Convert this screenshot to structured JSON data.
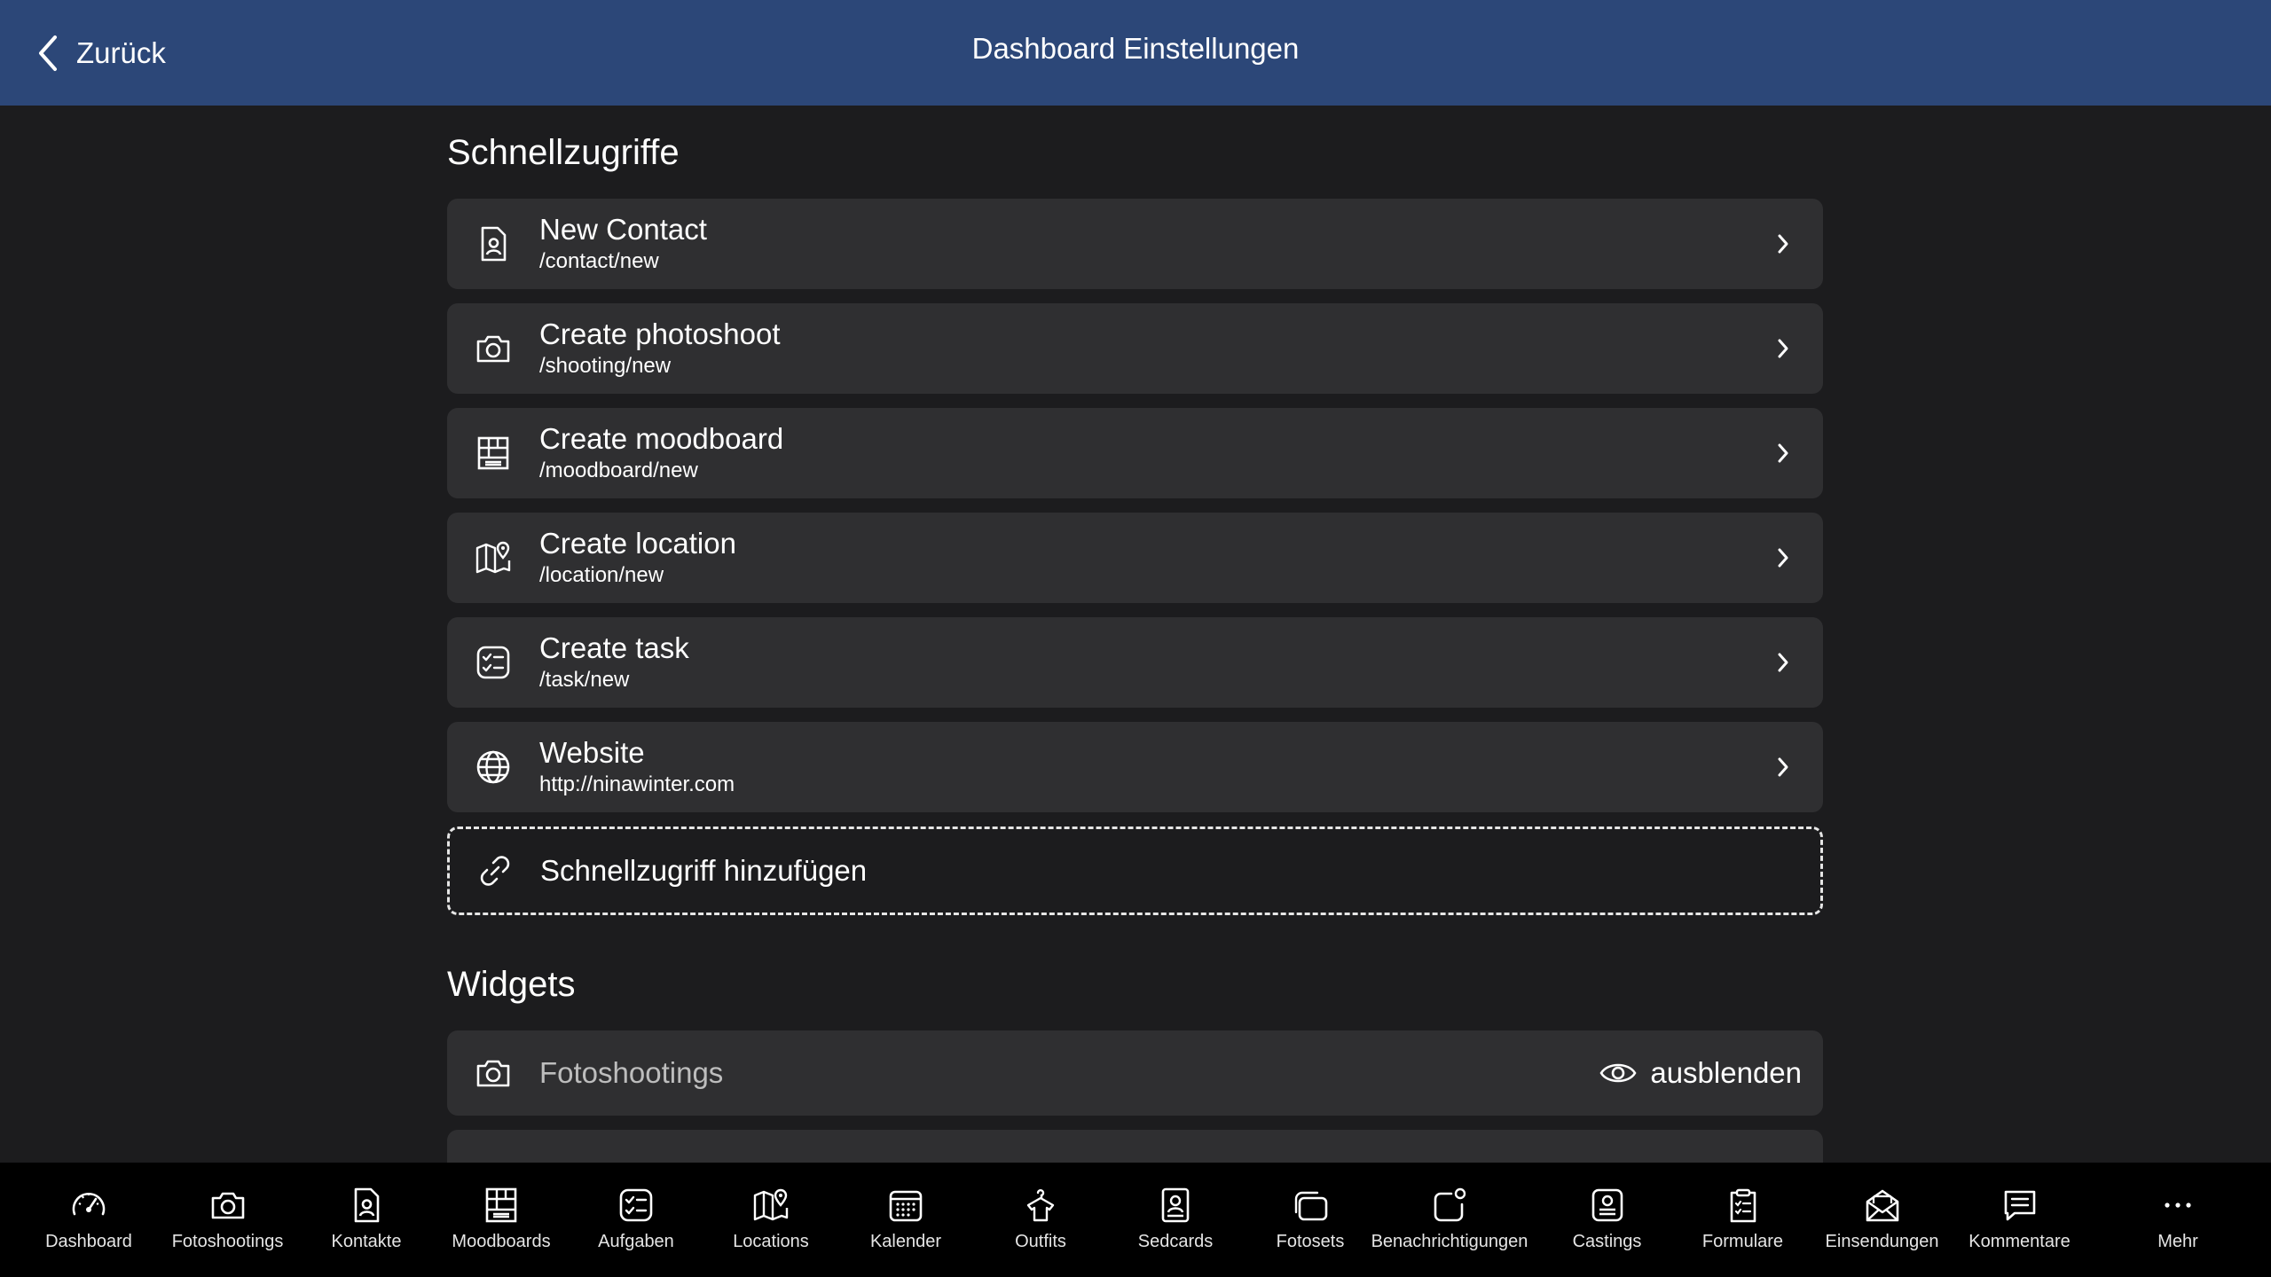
{
  "header": {
    "back_label": "Zurück",
    "title": "Dashboard Einstellungen",
    "color": "#2c4778"
  },
  "quick_access": {
    "section_title": "Schnellzugriffe",
    "items": [
      {
        "icon": "contact-card-icon",
        "title": "New Contact",
        "path": "/contact/new"
      },
      {
        "icon": "camera-icon",
        "title": "Create photoshoot",
        "path": "/shooting/new"
      },
      {
        "icon": "moodboard-grid-icon",
        "title": "Create moodboard",
        "path": "/moodboard/new"
      },
      {
        "icon": "map-pin-icon",
        "title": "Create location",
        "path": "/location/new"
      },
      {
        "icon": "task-list-icon",
        "title": "Create task",
        "path": "/task/new"
      },
      {
        "icon": "globe-icon",
        "title": "Website",
        "path": "http://ninawinter.com"
      }
    ],
    "add_label": "Schnellzugriff hinzufügen"
  },
  "widgets": {
    "section_title": "Widgets",
    "items": [
      {
        "icon": "camera-icon",
        "name": "Fotoshootings",
        "toggle_label": "ausblenden"
      }
    ]
  },
  "tabbar": {
    "items": [
      {
        "label": "Dashboard",
        "icon": "speedometer-icon"
      },
      {
        "label": "Fotoshootings",
        "icon": "camera-icon"
      },
      {
        "label": "Kontakte",
        "icon": "contact-card-icon"
      },
      {
        "label": "Moodboards",
        "icon": "moodboard-grid-icon"
      },
      {
        "label": "Aufgaben",
        "icon": "task-list-icon"
      },
      {
        "label": "Locations",
        "icon": "map-pin-icon"
      },
      {
        "label": "Kalender",
        "icon": "calendar-icon"
      },
      {
        "label": "Outfits",
        "icon": "hanger-shirt-icon"
      },
      {
        "label": "Sedcards",
        "icon": "sedcard-icon"
      },
      {
        "label": "Fotosets",
        "icon": "photo-stack-icon"
      },
      {
        "label": "Benachrichtigungen",
        "icon": "notification-icon"
      },
      {
        "label": "Castings",
        "icon": "casting-badge-icon"
      },
      {
        "label": "Formulare",
        "icon": "clipboard-icon"
      },
      {
        "label": "Einsendungen",
        "icon": "envelope-icon"
      },
      {
        "label": "Kommentare",
        "icon": "comment-icon"
      },
      {
        "label": "Mehr",
        "icon": "more-dots-icon"
      }
    ]
  }
}
